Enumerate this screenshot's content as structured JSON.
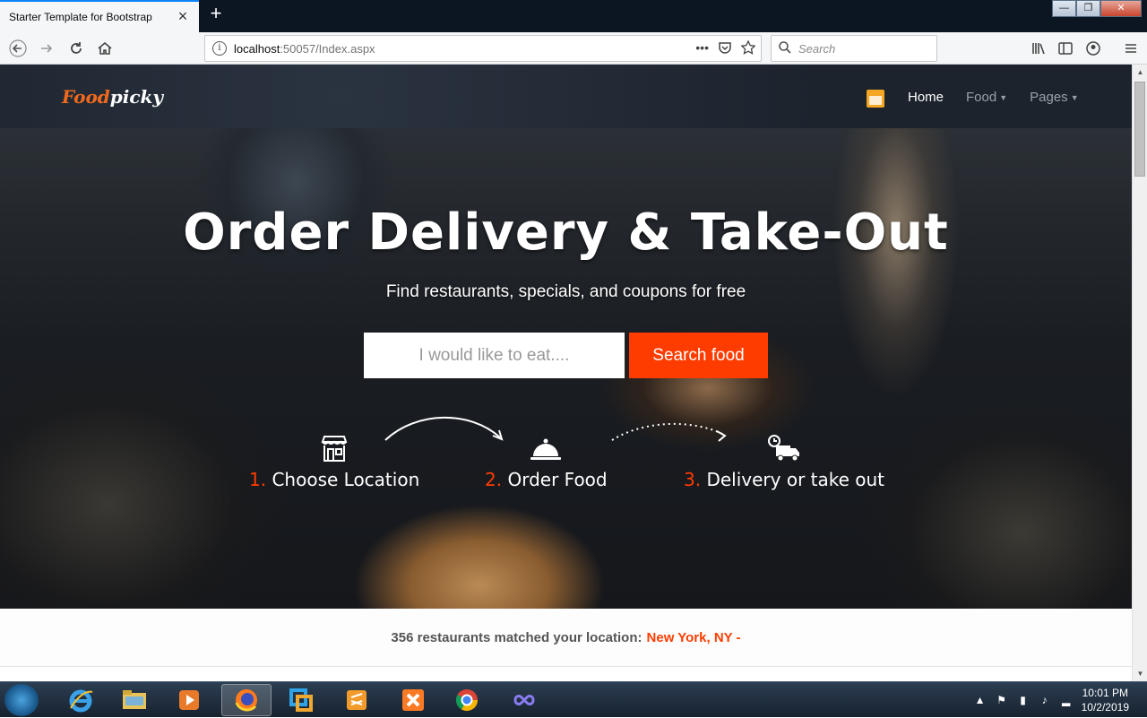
{
  "browser": {
    "tab_title": "Starter Template for Bootstrap",
    "tab_close": "×",
    "new_tab": "+",
    "url_host": "localhost",
    "url_rest": ":50057/Index.aspx",
    "url_more": "•••",
    "search_placeholder": "Search",
    "window_controls": {
      "minimize": "—",
      "maximize": "❐",
      "close": "✕"
    }
  },
  "site": {
    "logo_part1": "Food",
    "logo_part2": "picky",
    "nav": {
      "home": "Home",
      "food": "Food",
      "pages": "Pages"
    }
  },
  "hero": {
    "title": "Order Delivery & Take-Out",
    "subtitle": "Find restaurants, specials, and coupons for free",
    "search_placeholder": "I would like to eat....",
    "search_button": "Search food",
    "steps": [
      {
        "num": "1.",
        "label": "Choose Location",
        "icon": "store-icon"
      },
      {
        "num": "2.",
        "label": "Order Food",
        "icon": "cloche-icon"
      },
      {
        "num": "3.",
        "label": "Delivery or take out",
        "icon": "delivery-truck-icon"
      }
    ]
  },
  "results": {
    "text": "356 restaurants matched your location:",
    "city": "New York, NY -"
  },
  "taskbar": {
    "time": "10:01 PM",
    "date": "10/2/2019",
    "apps": [
      "internet-explorer",
      "file-explorer",
      "media-player",
      "firefox",
      "app-blue",
      "sublime-text",
      "xampp",
      "chrome",
      "app-infinity"
    ]
  },
  "colors": {
    "accent": "#ff3c00",
    "logo_orange": "#f06a1d",
    "nav_bg": "#1e2632"
  }
}
